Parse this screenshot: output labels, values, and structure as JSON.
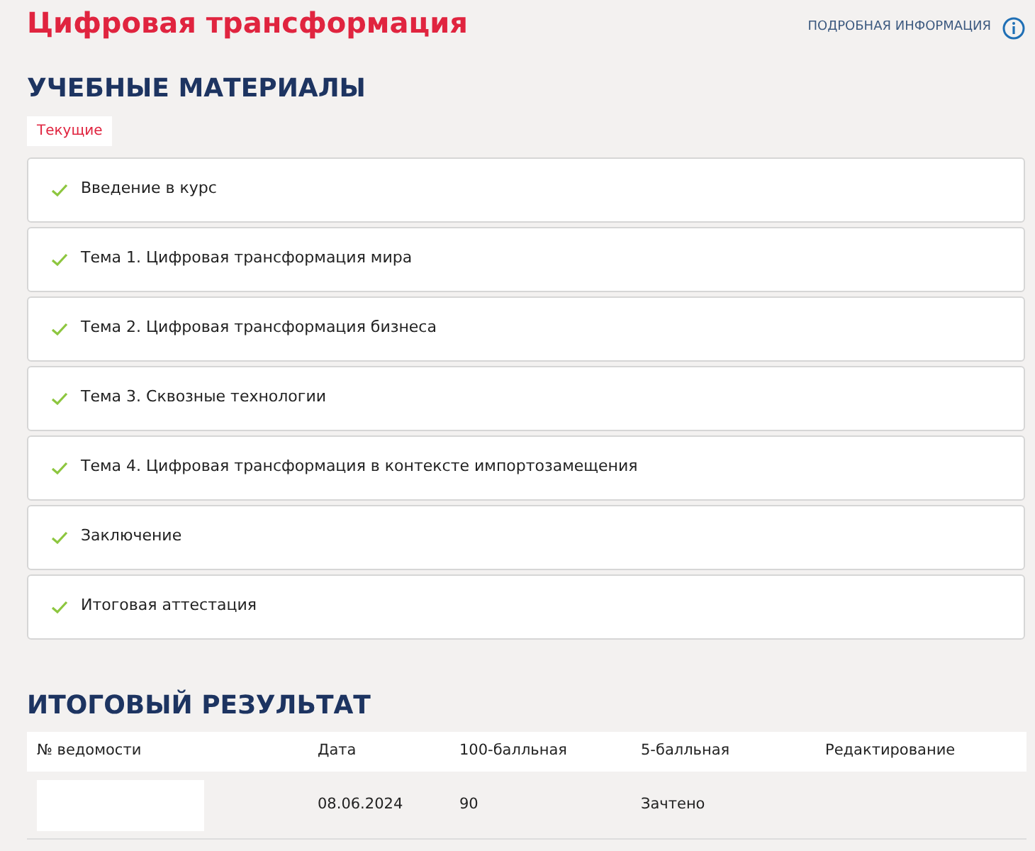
{
  "title": "Цифровая трансформация",
  "info_link": {
    "label": "ПОДРОБНАЯ ИНФОРМАЦИЯ"
  },
  "materials": {
    "heading": "УЧЕБНЫЕ МАТЕРИАЛЫ",
    "tabs": [
      {
        "label": "Текущие",
        "selected": true
      }
    ],
    "items": [
      {
        "label": "Введение в курс",
        "completed": true
      },
      {
        "label": "Тема 1. Цифровая трансформация мира",
        "completed": true
      },
      {
        "label": "Тема 2. Цифровая трансформация бизнеса",
        "completed": true
      },
      {
        "label": "Тема 3. Сквозные технологии",
        "completed": true
      },
      {
        "label": "Тема 4. Цифровая трансформация в контексте импортозамещения",
        "completed": true
      },
      {
        "label": "Заключение",
        "completed": true
      },
      {
        "label": "Итоговая аттестация",
        "completed": true
      }
    ]
  },
  "result": {
    "heading": "ИТОГОВЫЙ РЕЗУЛЬТАТ",
    "columns": [
      "№ ведомости",
      "Дата",
      "100-балльная",
      "5-балльная",
      "Редактирование"
    ],
    "rows": [
      {
        "cells": [
          {
            "kind": "redacted"
          },
          {
            "kind": "text",
            "text": "08.06.2024"
          },
          {
            "kind": "text",
            "text": "90"
          },
          {
            "kind": "text",
            "text": "Зачтено"
          },
          {
            "kind": "empty"
          }
        ]
      }
    ]
  }
}
